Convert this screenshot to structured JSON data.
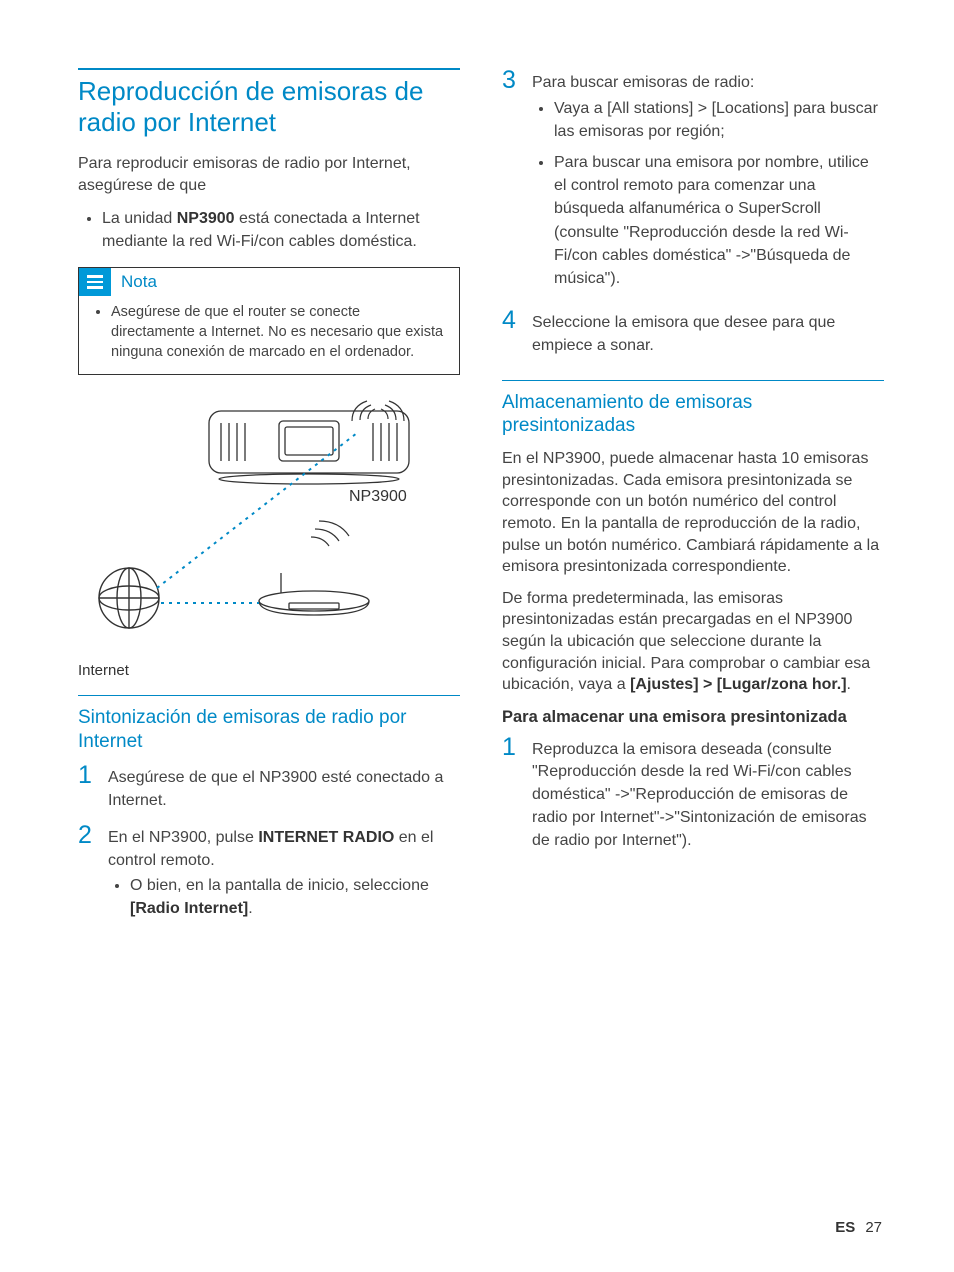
{
  "left": {
    "heading": "Reproducción de emisoras de radio por Internet",
    "intro": "Para reproducir emisoras de radio por Internet, asegúrese de que",
    "bullet_pre": "La unidad ",
    "bullet_bold": "NP3900",
    "bullet_post": " está conectada a Internet mediante la red Wi-Fi/con cables doméstica.",
    "note_label": "Nota",
    "note_body": "Asegúrese de que el router se conecte directamente a Internet. No es necesario que exista ninguna conexión de marcado en el ordenador.",
    "diagram_device_label": "NP3900",
    "diagram_caption": "Internet",
    "sub_heading": "Sintonización de emisoras de radio por Internet",
    "step1": "Asegúrese de que el NP3900 esté conectado a Internet.",
    "step2_pre": "En el NP3900, pulse ",
    "step2_bold": "INTERNET RADIO",
    "step2_post": " en el control remoto.",
    "step2_sub_pre": "O bien, en la pantalla de inicio, seleccione ",
    "step2_sub_bold": "[Radio Internet]",
    "step2_sub_post": "."
  },
  "right": {
    "step3_intro": "Para buscar emisoras de radio:",
    "step3_b1_pre": "Vaya a ",
    "step3_b1_nav": "[All stations] > [Locations]",
    "step3_b1_post": " para buscar las emisoras por región;",
    "step3_b2": "Para buscar una emisora por nombre, utilice el control remoto para comenzar una búsqueda alfanumérica o SuperScroll (consulte \"Reproducción desde la red Wi-Fi/con cables doméstica\" ->\"Búsqueda de música\").",
    "step4": "Seleccione la emisora que desee para que empiece a sonar.",
    "sub_heading": "Almacenamiento de emisoras presintonizadas",
    "para1": "En el NP3900, puede almacenar hasta 10 emisoras presintonizadas. Cada emisora presintonizada se corresponde con un botón numérico del control remoto. En la pantalla de reproducción de la radio, pulse un botón numérico. Cambiará rápidamente a la emisora presintonizada correspondiente.",
    "para2_pre": "De forma predeterminada, las emisoras presintonizadas están precargadas en el NP3900 según la ubicación que seleccione durante la configuración inicial. Para comprobar o cambiar esa ubicación, vaya a ",
    "para2_bold": "[Ajustes] > [Lugar/zona hor.]",
    "para2_post": ".",
    "para_head": "Para almacenar una emisora presintonizada",
    "pstep1": "Reproduzca la emisora deseada (consulte \"Reproducción desde la red Wi-Fi/con cables doméstica\" ->\"Reproducción de emisoras de radio por Internet\"->\"Sintonización de emisoras de radio por Internet\")."
  },
  "footer": {
    "lang": "ES",
    "page": "27"
  }
}
